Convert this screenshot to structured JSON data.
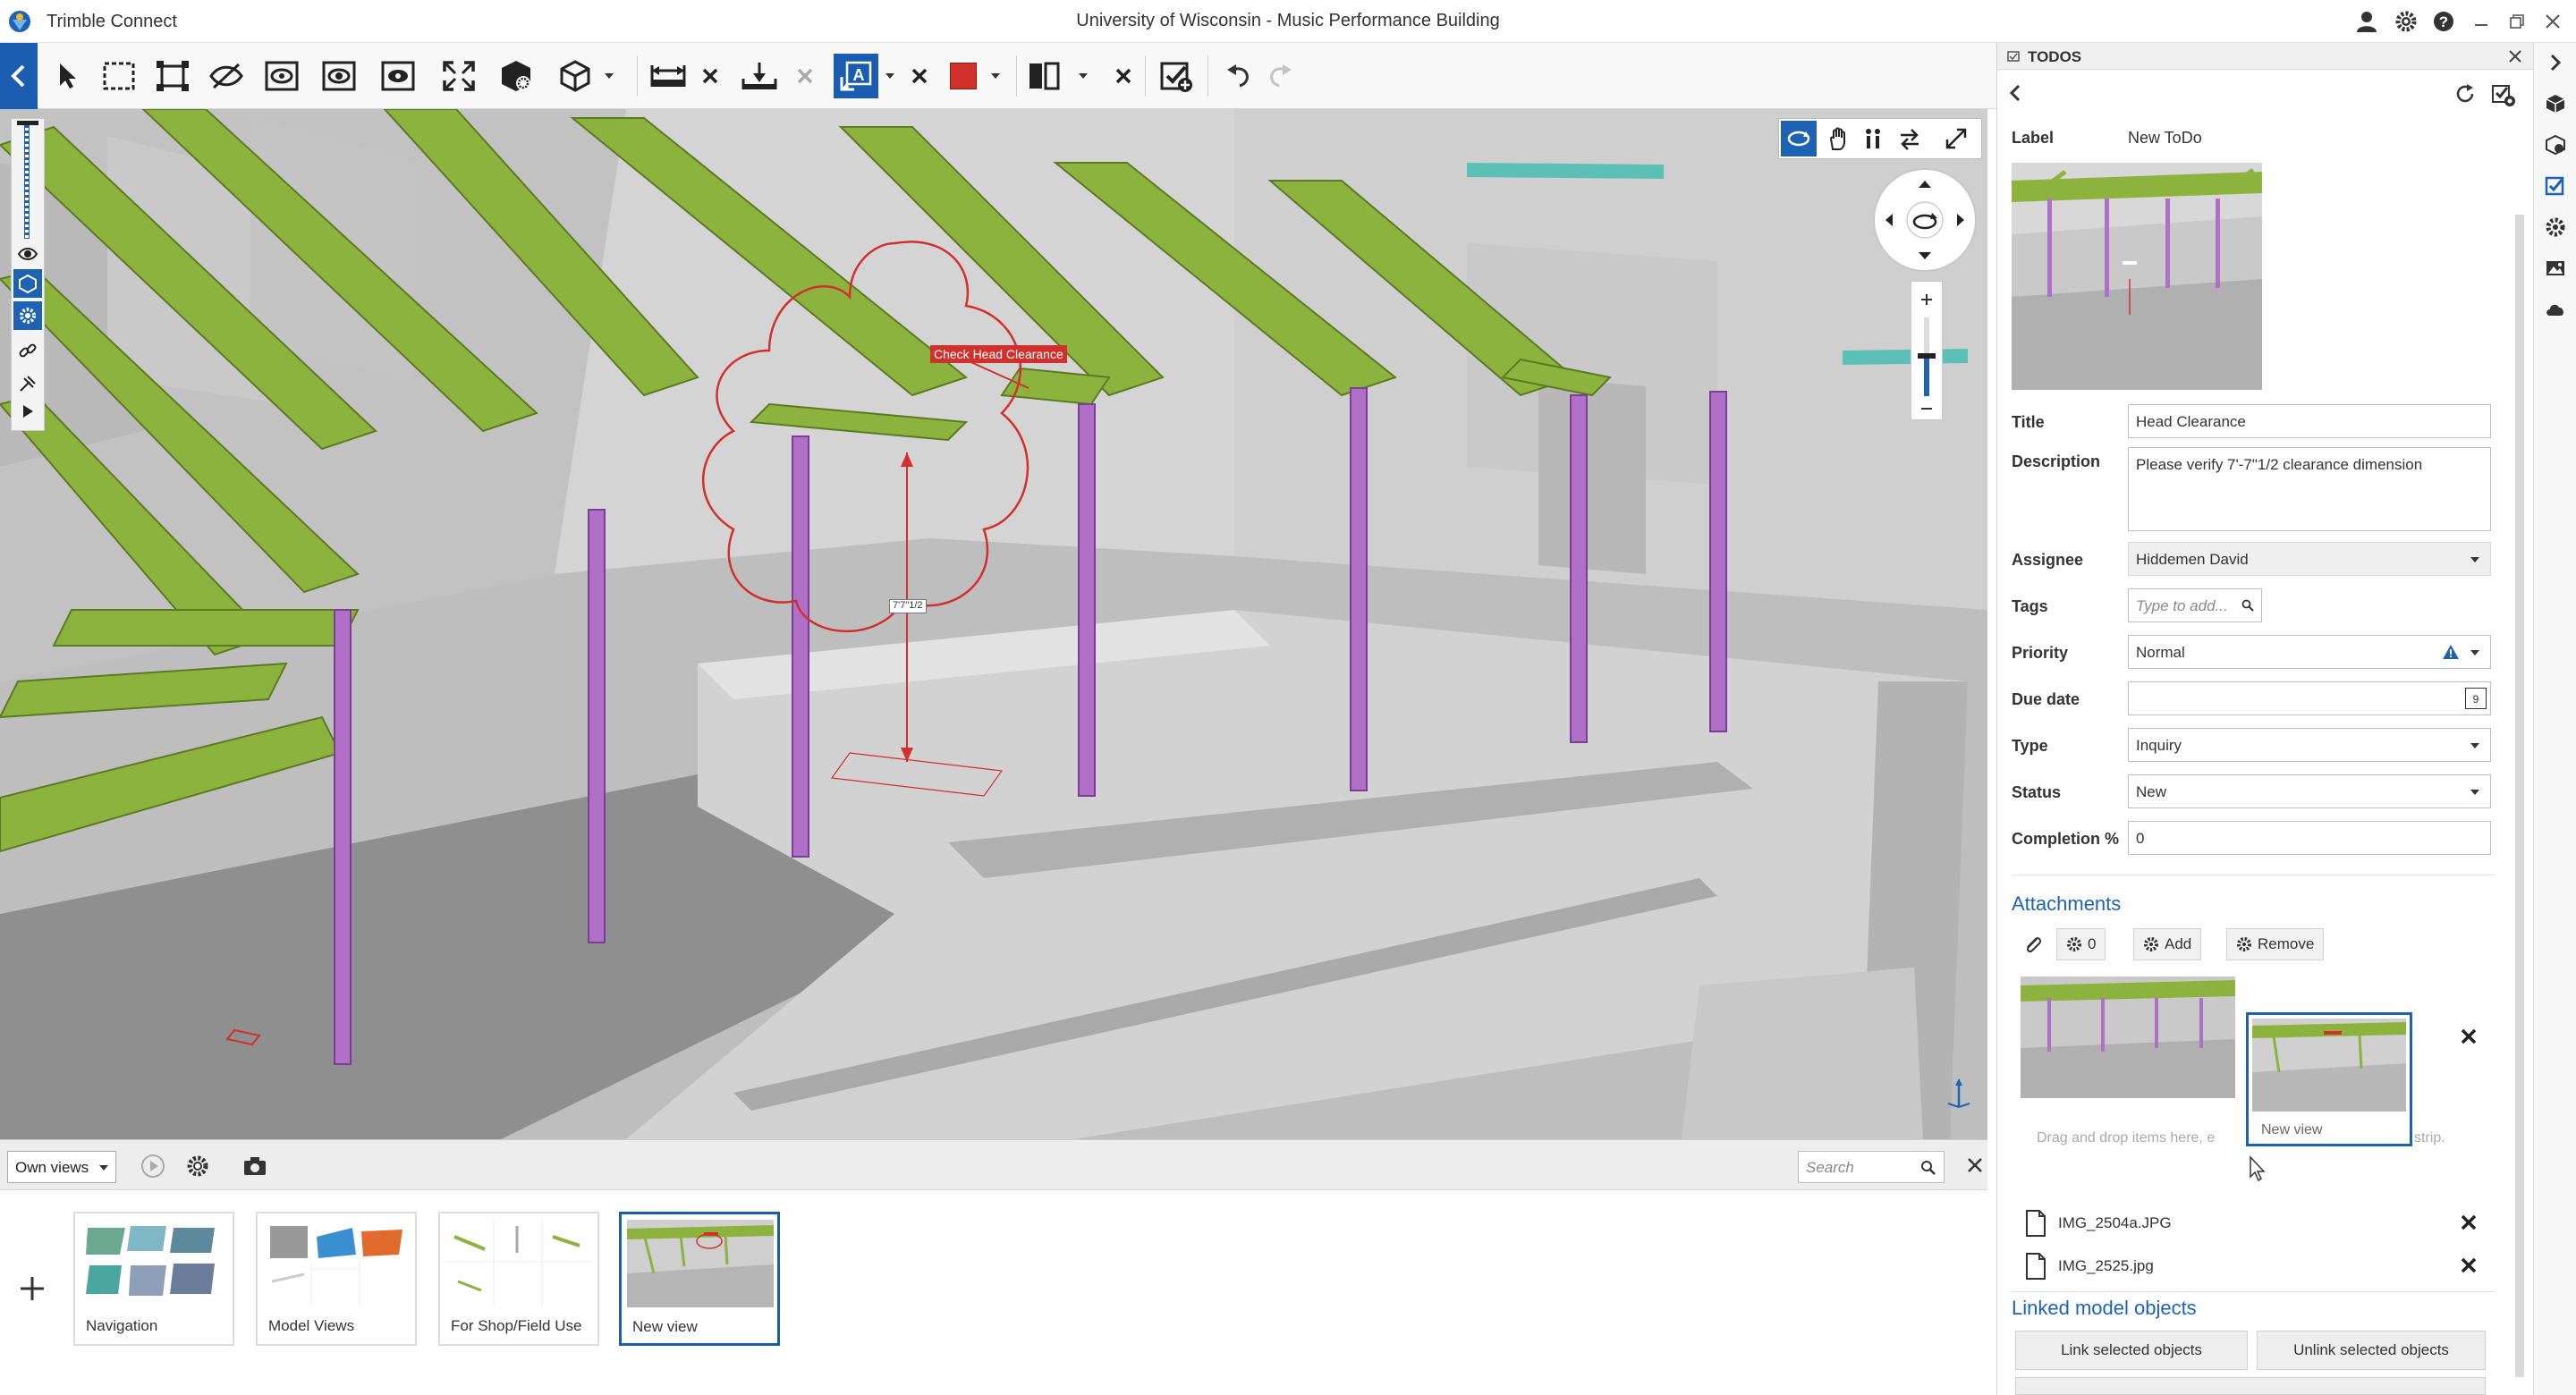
{
  "app": {
    "name": "Trimble Connect",
    "document_title": "University of Wisconsin - Music Performance Building"
  },
  "toolbar": {
    "tools": [
      "back-arrow-icon",
      "select-pointer-icon",
      "box-select-icon",
      "fit-select-icon",
      "hide-icon",
      "isolate-icon",
      "show-all-icon",
      "ghost-icon",
      "fit-all-icon",
      "object-settings-icon",
      "view-cube-icon",
      "measure-icon",
      "clear-measure-icon",
      "section-plane-icon",
      "clear-section-icon",
      "markup-text-icon",
      "clear-markup-icon",
      "color-picker-icon",
      "split-view-icon",
      "close-split-icon",
      "add-todo-icon",
      "undo-icon",
      "redo-icon"
    ],
    "markup_color": "#d0312d",
    "accent": "#1a5cb0"
  },
  "viewport": {
    "callout_text": "Check Head Clearance",
    "dimension_text": "7'7\"1/2"
  },
  "views_panel": {
    "filter_label": "Own views",
    "search_placeholder": "Search",
    "cards": [
      {
        "label": "Navigation"
      },
      {
        "label": "Model Views"
      },
      {
        "label": "For Shop/Field Use"
      },
      {
        "label": "New view",
        "selected": true
      }
    ]
  },
  "todos": {
    "panel_title": "TODOS",
    "label_key": "Label",
    "label_value": "New ToDo",
    "title_label": "Title",
    "title_value": "Head Clearance",
    "description_label": "Description",
    "description_value": "Please verify 7'-7\"1/2 clearance dimension",
    "assignee_label": "Assignee",
    "assignee_value": "Hiddemen David",
    "tags_label": "Tags",
    "tags_placeholder": "Type to add...",
    "priority_label": "Priority",
    "priority_value": "Normal",
    "due_label": "Due date",
    "due_value": "",
    "due_icon_text": "9",
    "type_label": "Type",
    "type_value": "Inquiry",
    "status_label": "Status",
    "status_value": "New",
    "completion_label": "Completion %",
    "completion_value": "0",
    "attachments_title": "Attachments",
    "attach_count": "0",
    "add_label": "Add",
    "remove_label": "Remove",
    "drag_hint": "Drag and drop items here, e",
    "drag_hint_tail": "strip.",
    "dragging_view_label": "New view",
    "files": [
      "IMG_2504a.JPG",
      "IMG_2525.jpg"
    ],
    "linked_title": "Linked model objects",
    "link_button": "Link selected objects",
    "unlink_button": "Unlink selected objects"
  },
  "colors": {
    "beam_green": "#8db33f",
    "column_purple": "#b070c8",
    "accent_blue": "#1d62b3"
  }
}
